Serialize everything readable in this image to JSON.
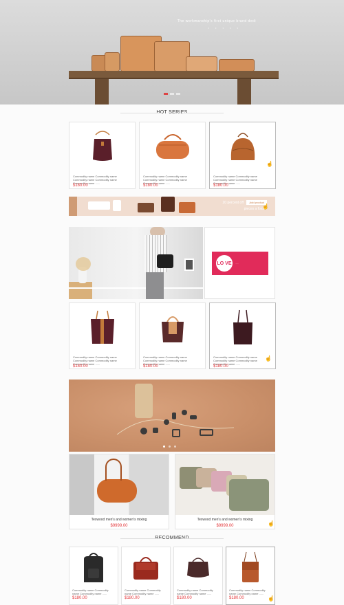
{
  "hero": {
    "tagline": "The workmanship's first unique brand dedi",
    "dots": [
      "",
      "",
      ""
    ]
  },
  "sections": {
    "hot_series": "HOT SERIES",
    "recommend": "RECOMMEND"
  },
  "hot_products": [
    {
      "name": "Commodity name Commodity name Commodity name Commodity name Commodity name ......",
      "price": "$180.00",
      "icon": "bucket-bag-icon",
      "color": "#5a1f2a"
    },
    {
      "name": "Commodity name Commodity name Commodity name Commodity name Commodity name ......",
      "price": "$180.00",
      "icon": "barrel-bag-icon",
      "color": "#d9763e"
    },
    {
      "name": "Commodity name Commodity name Commodity name Commodity name Commodity name ......",
      "price": "$180.00",
      "icon": "dome-bag-icon",
      "color": "#b8652f"
    }
  ],
  "promo": {
    "line1": "20 percent off",
    "button": "Add product",
    "line2": "pieces a foxset"
  },
  "love_banner": {
    "logo": "LO VE",
    "text": "......"
  },
  "products_2": [
    {
      "name": "Commodity name Commodity name Commodity name Commodity name Commodity name ......",
      "price": "$180.00",
      "icon": "tote-bag-icon",
      "color": "#5a1f2a"
    },
    {
      "name": "Commodity name Commodity name Commodity name Commodity name Commodity name ......",
      "price": "$180.00",
      "icon": "handbag-icon",
      "color": "#5a2a2a"
    },
    {
      "name": "Commodity name Commodity name Commodity name Commodity name Commodity name ......",
      "price": "$180.00",
      "icon": "shopper-bag-icon",
      "color": "#3d1a20"
    }
  ],
  "leather_banner": {
    "dots": [
      "",
      "",
      ""
    ]
  },
  "big_items": [
    {
      "caption": "Texwood men's and women's mixing",
      "price": "$9999.00"
    },
    {
      "caption": "Texwood men's and women's mixing",
      "price": "$9999.00"
    }
  ],
  "recommend_products": [
    {
      "name": "Commodity name Commodity name Commodity name ......",
      "price": "$180.00",
      "icon": "backpack-icon",
      "color": "#2a2a2a"
    },
    {
      "name": "Commodity name Commodity name Commodity name ......",
      "price": "$180.00",
      "icon": "satchel-icon",
      "color": "#9a2a1e"
    },
    {
      "name": "Commodity name Commodity name Commodity name ......",
      "price": "$180.00",
      "icon": "hobo-bag-icon",
      "color": "#4a2a2a"
    },
    {
      "name": "Commodity name Commodity name Commodity name ......",
      "price": "$180.00",
      "icon": "crossbody-bag-icon",
      "color": "#b8592d"
    }
  ],
  "colors": {
    "price": "#e4393c",
    "accent": "#e12b5a",
    "leather": "#c98f69"
  }
}
